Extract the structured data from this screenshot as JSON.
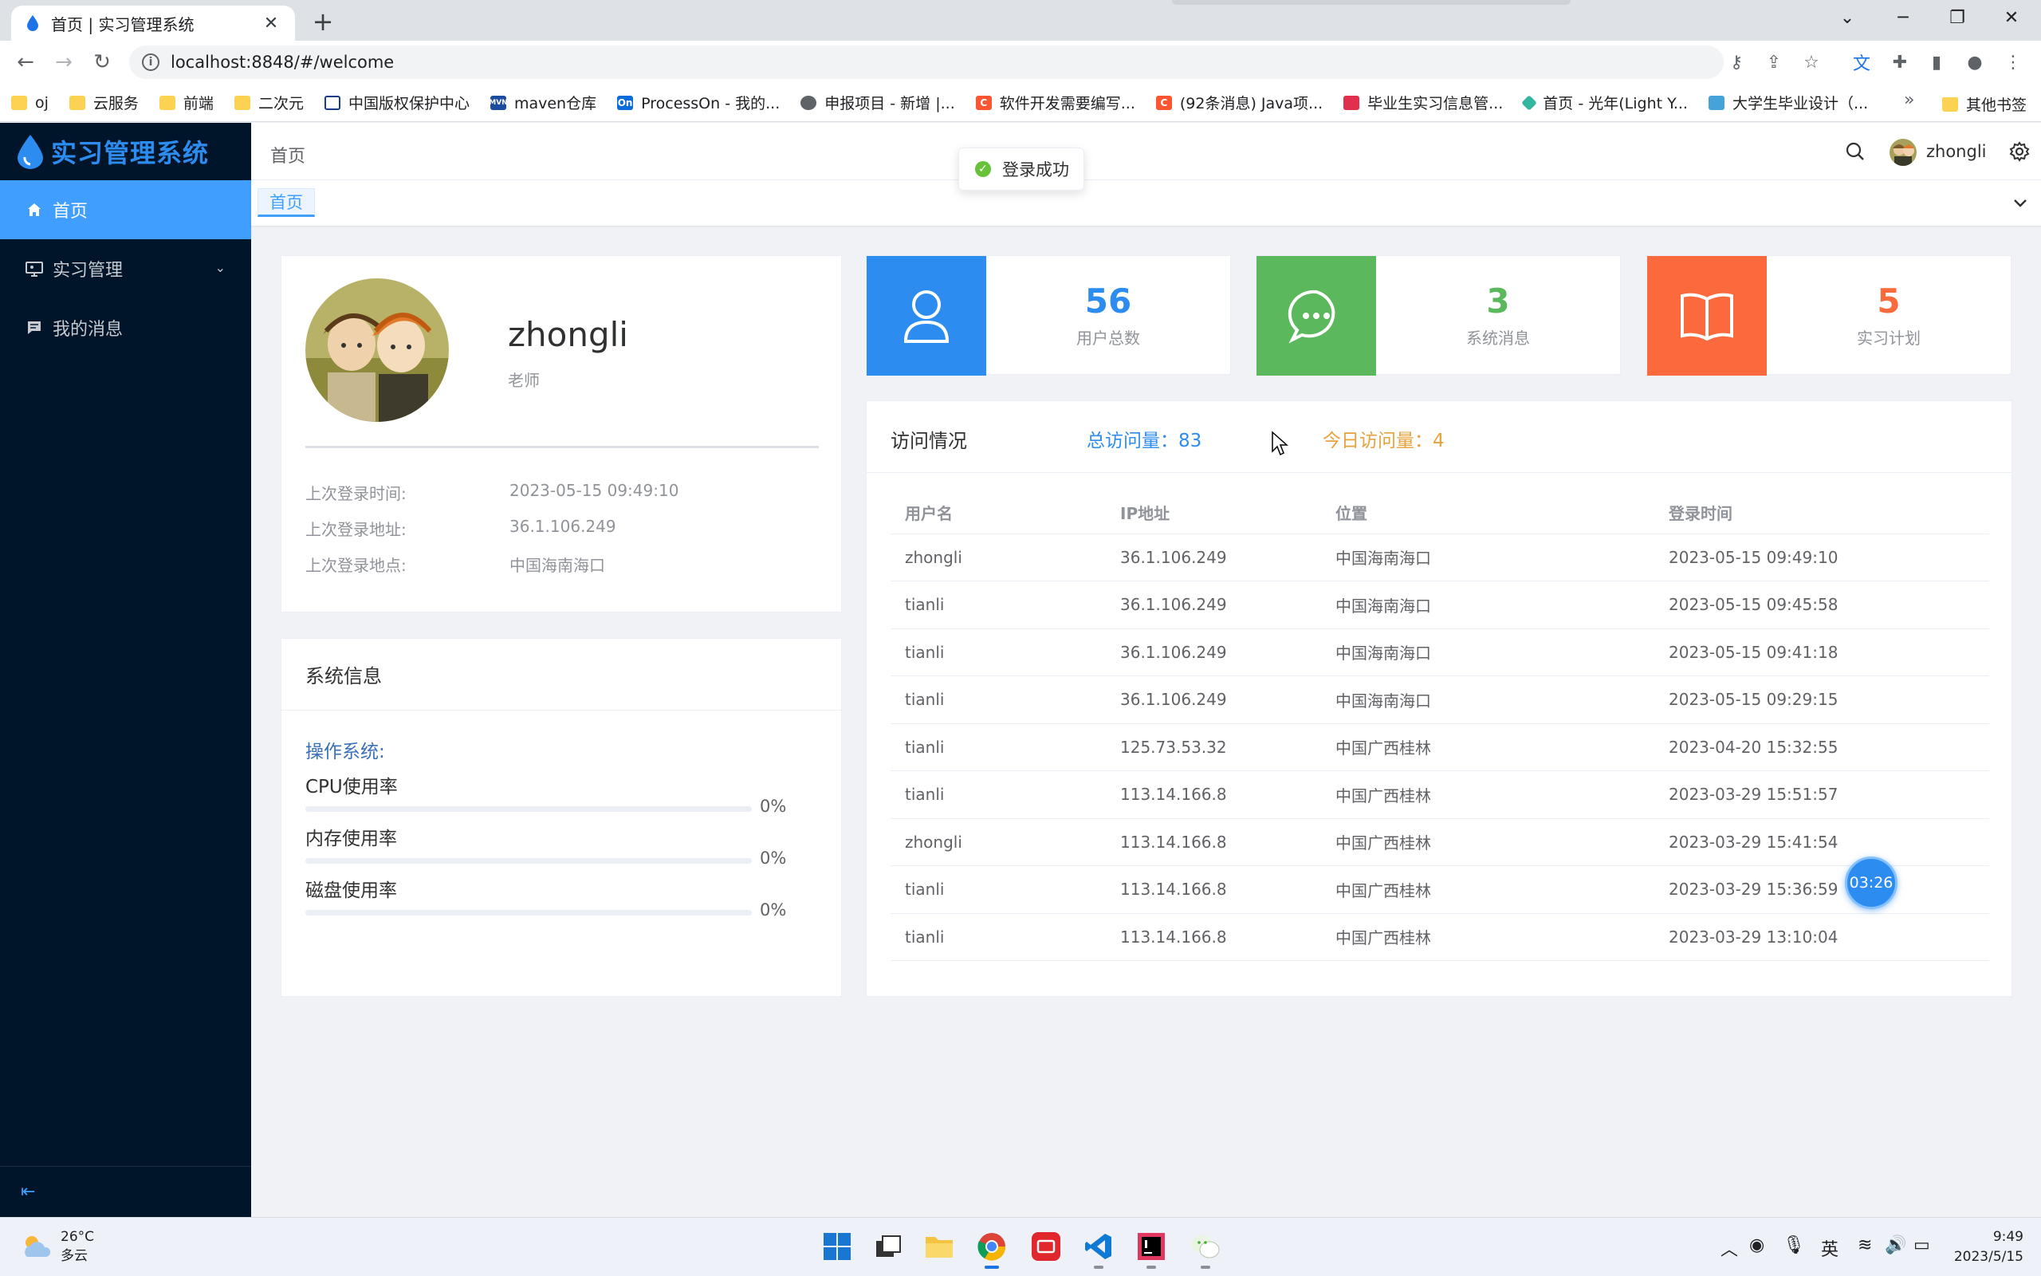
{
  "browser": {
    "tab_title": "首页 | 实习管理系统",
    "url": "localhost:8848/#/welcome",
    "bookmarks": [
      {
        "label": "oj",
        "icon": "folder-icon"
      },
      {
        "label": "云服务",
        "icon": "folder-icon"
      },
      {
        "label": "前端",
        "icon": "folder-icon"
      },
      {
        "label": "二次元",
        "icon": "folder-icon"
      },
      {
        "label": "中国版权保护中心",
        "icon": "site-icon"
      },
      {
        "label": "maven仓库",
        "icon": "maven-icon"
      },
      {
        "label": "ProcessOn - 我的...",
        "icon": "processon-icon"
      },
      {
        "label": "申报项目 - 新增 |...",
        "icon": "globe-icon"
      },
      {
        "label": "软件开发需要编写...",
        "icon": "csdn-icon"
      },
      {
        "label": "(92条消息) Java项...",
        "icon": "csdn-icon"
      },
      {
        "label": "毕业生实习信息管...",
        "icon": "site-icon"
      },
      {
        "label": "首页 - 光年(Light Y...",
        "icon": "site-icon"
      },
      {
        "label": "大学生毕业设计（...",
        "icon": "site-icon"
      }
    ],
    "bookmarks_more": "»",
    "other_bookmarks": "其他书签"
  },
  "app": {
    "logo_text": "实习管理系统",
    "breadcrumb": "首页",
    "username": "zhongli",
    "toast": "登录成功",
    "tag": "首页",
    "menu": [
      {
        "label": "首页",
        "icon": "home-icon",
        "active": true
      },
      {
        "label": "实习管理",
        "icon": "monitor-icon",
        "active": false
      },
      {
        "label": "我的消息",
        "icon": "message-icon",
        "active": false
      }
    ]
  },
  "profile": {
    "name": "zhongli",
    "role": "老师",
    "rows": [
      {
        "label": "上次登录时间:",
        "value": "2023-05-15 09:49:10"
      },
      {
        "label": "上次登录地址:",
        "value": "36.1.106.249"
      },
      {
        "label": "上次登录地点:",
        "value": "中国海南海口"
      }
    ]
  },
  "system_info": {
    "title": "系统信息",
    "os_label": "操作系统:",
    "meters": [
      {
        "label": "CPU使用率",
        "percent": 0,
        "display": "0%"
      },
      {
        "label": "内存使用率",
        "percent": 0,
        "display": "0%"
      },
      {
        "label": "磁盘使用率",
        "percent": 0,
        "display": "0%"
      }
    ]
  },
  "stats": [
    {
      "value": "56",
      "label": "用户总数",
      "color": "#2d8cf0",
      "icon": "user-icon"
    },
    {
      "value": "3",
      "label": "系统消息",
      "color": "#5cb85c",
      "icon": "chat-icon"
    },
    {
      "value": "5",
      "label": "实习计划",
      "color": "#fa6a3c",
      "icon": "book-icon"
    }
  ],
  "visits": {
    "title": "访问情况",
    "total": "总访问量：83",
    "today": "今日访问量：4",
    "columns": [
      "用户名",
      "IP地址",
      "位置",
      "登录时间"
    ],
    "rows": [
      [
        "zhongli",
        "36.1.106.249",
        "中国海南海口",
        "2023-05-15 09:49:10"
      ],
      [
        "tianli",
        "36.1.106.249",
        "中国海南海口",
        "2023-05-15 09:45:58"
      ],
      [
        "tianli",
        "36.1.106.249",
        "中国海南海口",
        "2023-05-15 09:41:18"
      ],
      [
        "tianli",
        "36.1.106.249",
        "中国海南海口",
        "2023-05-15 09:29:15"
      ],
      [
        "tianli",
        "125.73.53.32",
        "中国广西桂林",
        "2023-04-20 15:32:55"
      ],
      [
        "tianli",
        "113.14.166.8",
        "中国广西桂林",
        "2023-03-29 15:51:57"
      ],
      [
        "zhongli",
        "113.14.166.8",
        "中国广西桂林",
        "2023-03-29 15:41:54"
      ],
      [
        "tianli",
        "113.14.166.8",
        "中国广西桂林",
        "2023-03-29 15:36:59"
      ],
      [
        "tianli",
        "113.14.166.8",
        "中国广西桂林",
        "2023-03-29 13:10:04"
      ]
    ]
  },
  "timer": "03:26",
  "taskbar": {
    "weather_temp": "26°C",
    "weather_desc": "多云",
    "ime": "英",
    "time": "9:49",
    "date": "2023/5/15"
  }
}
